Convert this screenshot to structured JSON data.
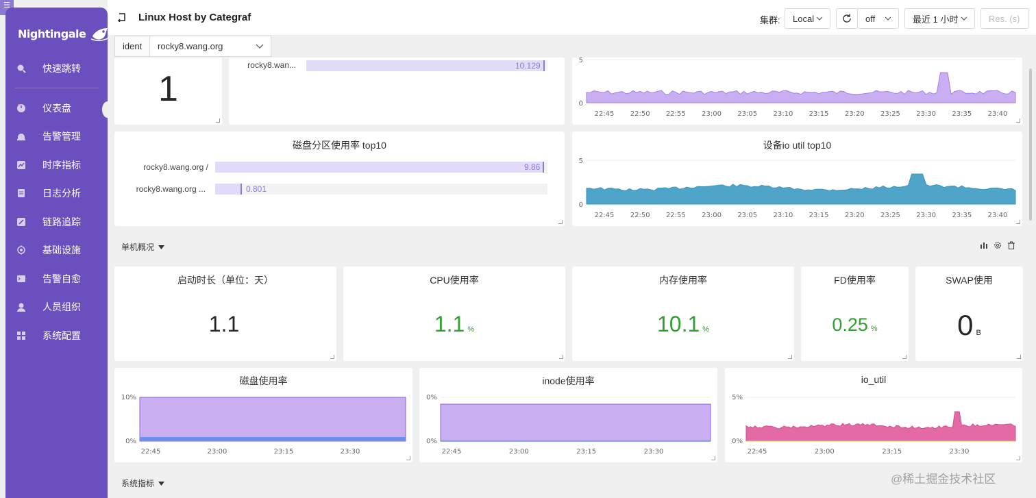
{
  "app": {
    "logo_text": "Nightingale",
    "menu": [
      {
        "label": "快速跳转",
        "icon": "search-icon"
      },
      {
        "label": "仪表盘",
        "icon": "dashboard-icon",
        "active": true
      },
      {
        "label": "告警管理",
        "icon": "alarm-bell-icon"
      },
      {
        "label": "时序指标",
        "icon": "line-chart-icon"
      },
      {
        "label": "日志分析",
        "icon": "document-icon"
      },
      {
        "label": "链路追踪",
        "icon": "tracing-icon"
      },
      {
        "label": "基础设施",
        "icon": "target-icon"
      },
      {
        "label": "告警自愈",
        "icon": "terminal-icon"
      },
      {
        "label": "人员组织",
        "icon": "user-icon"
      },
      {
        "label": "系统配置",
        "icon": "settings-grid-icon"
      }
    ]
  },
  "header": {
    "title": "Linux Host by Categraf",
    "cluster_label": "集群:",
    "cluster_value": "Local",
    "refresh_value": "off",
    "time_range": "最近 1 小时",
    "resolution_placeholder": "Res. (s)"
  },
  "variables": {
    "ident_label": "ident",
    "ident_value": "rocky8.wang.org"
  },
  "top_panels": {
    "stat_value": "1",
    "bar_item_label": "rocky8.wan...",
    "bar_item_value": "10.129",
    "bar_item_fraction": 0.99,
    "chart_y_top": "5",
    "chart_y_bottom": "0"
  },
  "time_ticks": [
    "22:45",
    "22:50",
    "22:55",
    "23:00",
    "23:05",
    "23:10",
    "23:15",
    "23:20",
    "23:25",
    "23:30",
    "23:35",
    "23:40"
  ],
  "disk_partition_panel": {
    "title": "磁盘分区使用率 top10",
    "items": [
      {
        "label": "rocky8.wang.org /",
        "value": "9.86",
        "fraction": 0.99
      },
      {
        "label": "rocky8.wang.org ...",
        "value": "0.801",
        "fraction": 0.08
      }
    ]
  },
  "io_util_top_panel": {
    "title": "设备io util top10",
    "y_top": "5",
    "y_bottom": "0"
  },
  "row_single": {
    "title": "单机概况"
  },
  "stats": [
    {
      "title": "启动时长（单位：天）",
      "value": "1.1",
      "unit": "",
      "color": "#262626"
    },
    {
      "title": "CPU使用率",
      "value": "1.1",
      "unit": "%",
      "color": "#2ea12e"
    },
    {
      "title": "内存使用率",
      "value": "10.1",
      "unit": "%",
      "color": "#2ea12e"
    },
    {
      "title": "FD使用率",
      "value": "0.25",
      "unit": "%",
      "color": "#2ea12e"
    },
    {
      "title": "SWAP使用",
      "value": "0",
      "unit": "B",
      "color": "#262626"
    }
  ],
  "bottom_ticks": [
    "22:45",
    "23:00",
    "23:15",
    "23:30"
  ],
  "disk_usage_panel": {
    "title": "磁盘使用率",
    "y_top": "10%",
    "y_bottom": "0%"
  },
  "inode_panel": {
    "title": "inode使用率",
    "y_top": "0%",
    "y_bottom": "0%"
  },
  "io_util_panel": {
    "title": "io_util",
    "y_top": "5%",
    "y_bottom": "0%"
  },
  "row_system": {
    "title": "系统指标"
  },
  "watermark": "@稀土掘金技术社区",
  "colors": {
    "sidebar": "#6a50bf",
    "purple_area": "#c9aef2",
    "teal_area": "#4ea5c9",
    "pink_area": "#e36aa5",
    "green_value": "#2ea12e"
  }
}
